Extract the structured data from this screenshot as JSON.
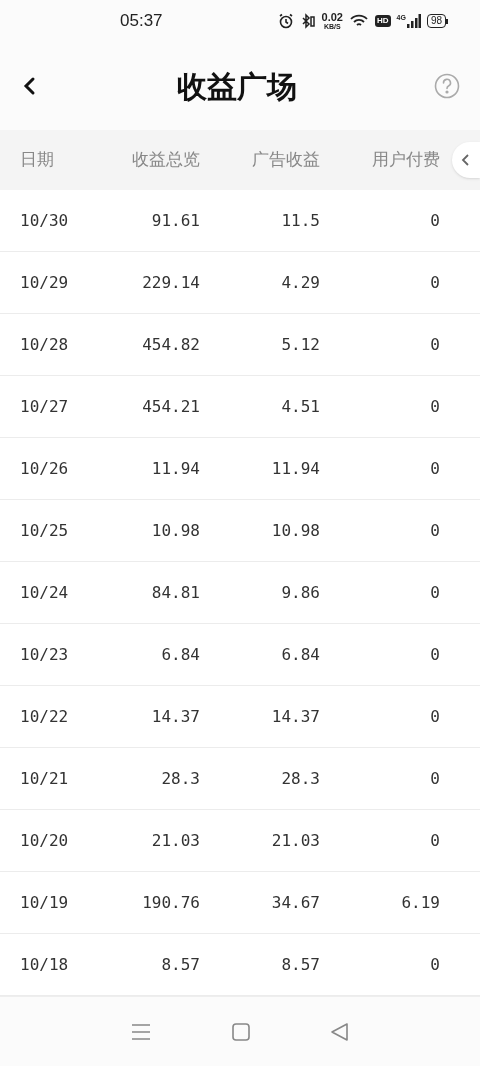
{
  "status_bar": {
    "time": "05:37",
    "net_speed": "0.02",
    "net_unit": "KB/S",
    "hd": "HD",
    "network": "4G",
    "battery": "98"
  },
  "header": {
    "title": "收益广场"
  },
  "table": {
    "columns": [
      "日期",
      "收益总览",
      "广告收益",
      "用户付费"
    ],
    "rows": [
      [
        "10/30",
        "91.61",
        "11.5",
        "0"
      ],
      [
        "10/29",
        "229.14",
        "4.29",
        "0"
      ],
      [
        "10/28",
        "454.82",
        "5.12",
        "0"
      ],
      [
        "10/27",
        "454.21",
        "4.51",
        "0"
      ],
      [
        "10/26",
        "11.94",
        "11.94",
        "0"
      ],
      [
        "10/25",
        "10.98",
        "10.98",
        "0"
      ],
      [
        "10/24",
        "84.81",
        "9.86",
        "0"
      ],
      [
        "10/23",
        "6.84",
        "6.84",
        "0"
      ],
      [
        "10/22",
        "14.37",
        "14.37",
        "0"
      ],
      [
        "10/21",
        "28.3",
        "28.3",
        "0"
      ],
      [
        "10/20",
        "21.03",
        "21.03",
        "0"
      ],
      [
        "10/19",
        "190.76",
        "34.67",
        "6.19"
      ],
      [
        "10/18",
        "8.57",
        "8.57",
        "0"
      ]
    ]
  }
}
